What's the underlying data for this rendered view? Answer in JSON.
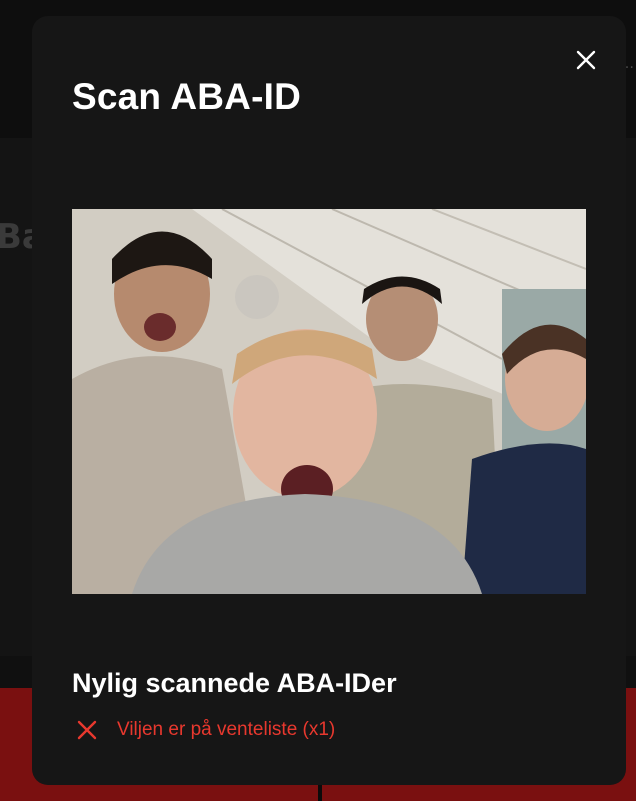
{
  "modal": {
    "title": "Scan ABA-ID",
    "close_icon": "close-icon",
    "camera_view": "camera-feed"
  },
  "recent": {
    "title": "Nylig scannede ABA-IDer",
    "items": [
      {
        "text": "Viljen er på venteliste (x1)",
        "status_icon": "x-icon",
        "status_color": "#e8382e"
      }
    ]
  },
  "background": {
    "title_fragment": "Ba",
    "header_fragment": "…"
  },
  "colors": {
    "modal_bg": "#161616",
    "error": "#e8382e",
    "accent_red": "#7a1010"
  }
}
